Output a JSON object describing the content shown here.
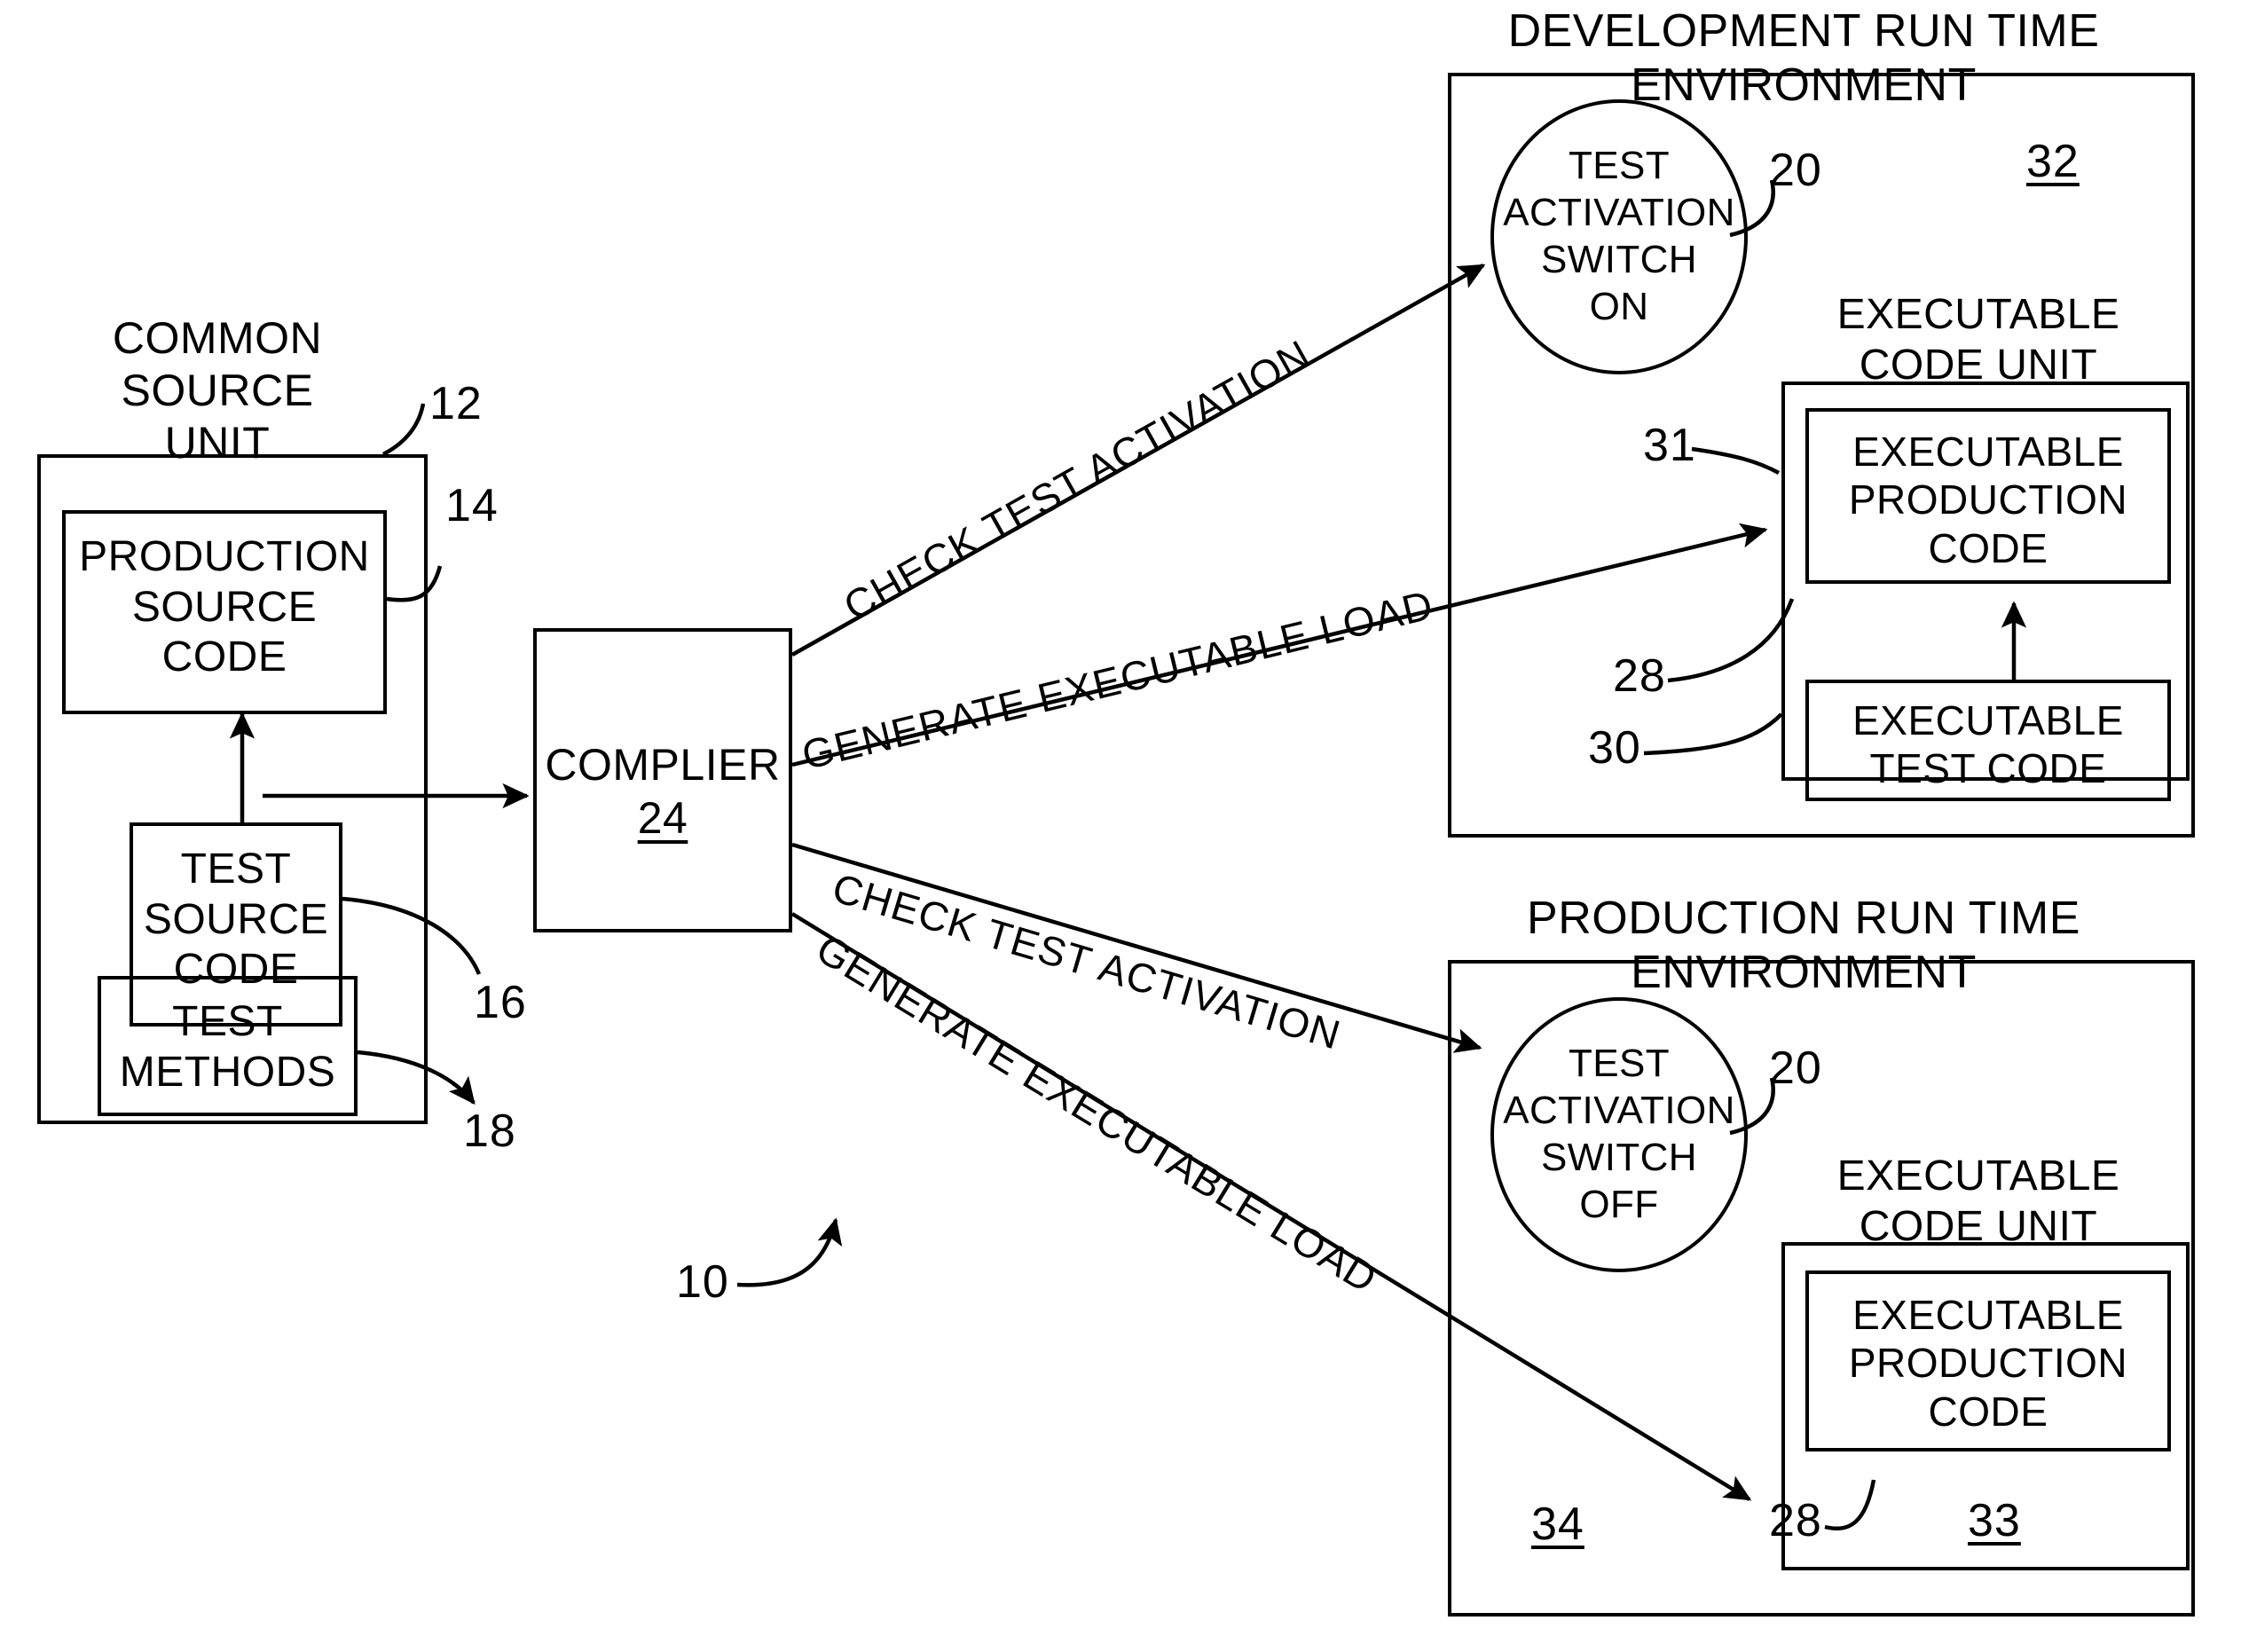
{
  "figure": {
    "figure_number": "10",
    "background_color": "#ffffff",
    "line_color": "#000000"
  },
  "source_unit": {
    "title": "COMMON\nSOURCE\nUNIT",
    "ref": "12",
    "production_source_code": {
      "label": "PRODUCTION\nSOURCE\nCODE",
      "ref": "14"
    },
    "test_source_code": {
      "label": "TEST\nSOURCE\nCODE",
      "ref": "16"
    },
    "test_methods": {
      "label": "TEST\nMETHODS",
      "ref": "18"
    }
  },
  "compiler": {
    "label": "COMPLIER",
    "ref": "24"
  },
  "arrows": {
    "check_test_activation": "CHECK TEST ACTIVATION",
    "generate_executable_load": "GENERATE EXECUTABLE LOAD"
  },
  "development_env": {
    "title": "DEVELOPMENT RUN TIME ENVIRONMENT",
    "ref": "32",
    "switch": {
      "label": "TEST\nACTIVATION\nSWITCH\nON",
      "ref": "20"
    },
    "code_unit": {
      "label": "EXECUTABLE\nCODE UNIT",
      "ref": "31"
    },
    "production_code": {
      "label": "EXECUTABLE\nPRODUCTION\nCODE",
      "ref": "28"
    },
    "test_code": {
      "label": "EXECUTABLE\nTEST CODE",
      "ref": "30"
    }
  },
  "production_env": {
    "title": "PRODUCTION RUN TIME ENVIRONMENT",
    "ref": "34",
    "switch": {
      "label": "TEST\nACTIVATION\nSWITCH\nOFF",
      "ref": "20"
    },
    "code_unit": {
      "label": "EXECUTABLE\nCODE UNIT",
      "ref": "33"
    },
    "production_code": {
      "label": "EXECUTABLE\nPRODUCTION\nCODE",
      "ref": "28"
    }
  }
}
